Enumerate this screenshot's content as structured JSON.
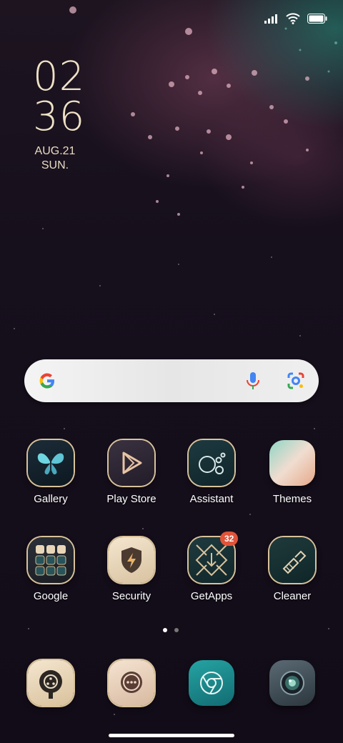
{
  "clock": {
    "hour": "02",
    "minute": "36",
    "date": "AUG.21",
    "day": "SUN."
  },
  "search": {
    "mic_icon": "mic-icon",
    "lens_icon": "lens-icon",
    "logo": "google-g-logo"
  },
  "apps_row1": [
    {
      "label": "Gallery",
      "icon": "butterfly-icon"
    },
    {
      "label": "Play Store",
      "icon": "play-icon"
    },
    {
      "label": "Assistant",
      "icon": "assistant-icon"
    },
    {
      "label": "Themes",
      "icon": "themes-icon"
    }
  ],
  "apps_row2": [
    {
      "label": "Google",
      "icon": "folder-icon"
    },
    {
      "label": "Security",
      "icon": "shield-icon"
    },
    {
      "label": "GetApps",
      "icon": "getapps-icon",
      "badge": "32"
    },
    {
      "label": "Cleaner",
      "icon": "brush-icon"
    }
  ],
  "dock": [
    {
      "icon": "phone-icon"
    },
    {
      "icon": "messages-icon"
    },
    {
      "icon": "chrome-icon"
    },
    {
      "icon": "camera-icon"
    }
  ],
  "pager": {
    "pages": 2,
    "current": 1
  },
  "colors": {
    "accent_gold": "#d8c29a",
    "badge_red": "#e0543a"
  }
}
